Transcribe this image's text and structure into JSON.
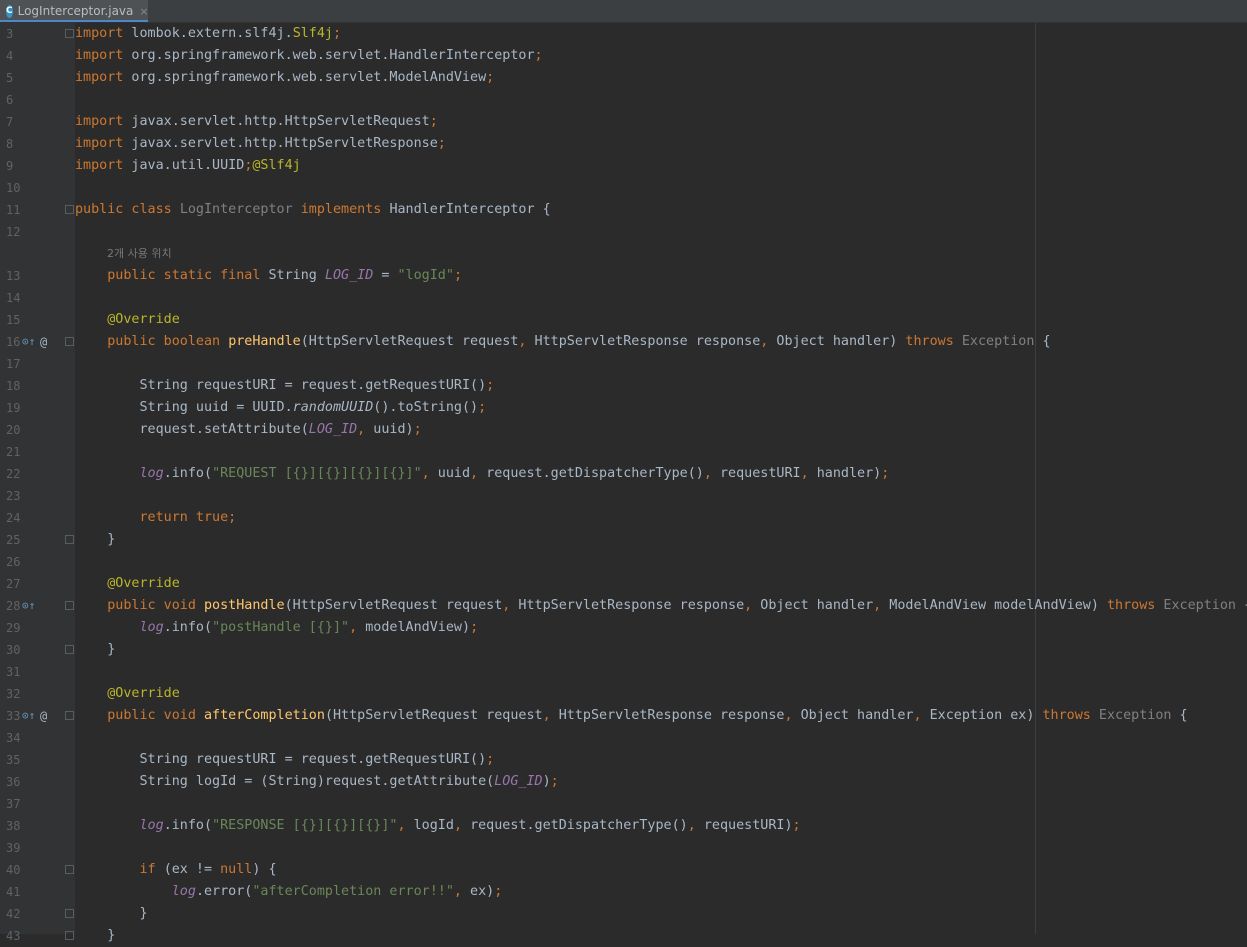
{
  "tab": {
    "filename": "LogInterceptor.java",
    "icon": "java-class-icon",
    "close": "×"
  },
  "colors": {
    "background": "#2b2b2b",
    "keyword": "#cc7832",
    "string": "#6a8759",
    "annotation": "#bbb529",
    "method": "#ffc66d",
    "constant": "#9876aa"
  },
  "code": {
    "l3": {
      "n": "3",
      "t": [
        [
          "kw",
          "import"
        ],
        [
          "p",
          " lombok.extern.slf4j."
        ],
        [
          "ann",
          "Slf4j"
        ],
        [
          "kw",
          ";"
        ]
      ]
    },
    "l4": {
      "n": "4",
      "t": [
        [
          "kw",
          "import"
        ],
        [
          "p",
          " org.springframework.web.servlet.HandlerInterceptor"
        ],
        [
          "kw",
          ";"
        ]
      ]
    },
    "l5": {
      "n": "5",
      "t": [
        [
          "kw",
          "import"
        ],
        [
          "p",
          " org.springframework.web.servlet.ModelAndView"
        ],
        [
          "kw",
          ";"
        ]
      ]
    },
    "l6": {
      "n": "6",
      "t": []
    },
    "l7": {
      "n": "7",
      "t": [
        [
          "kw",
          "import"
        ],
        [
          "p",
          " javax.servlet.http.HttpServletRequest"
        ],
        [
          "kw",
          ";"
        ]
      ]
    },
    "l8": {
      "n": "8",
      "t": [
        [
          "kw",
          "import"
        ],
        [
          "p",
          " javax.servlet.http.HttpServletResponse"
        ],
        [
          "kw",
          ";"
        ]
      ]
    },
    "l9": {
      "n": "9",
      "t": [
        [
          "kw",
          "import"
        ],
        [
          "p",
          " java.util.UUID"
        ],
        [
          "kw",
          ";"
        ],
        [
          "ann",
          "@Slf4j"
        ]
      ]
    },
    "l10": {
      "n": "10",
      "t": []
    },
    "l11": {
      "n": "11",
      "t": [
        [
          "kw",
          "public class "
        ],
        [
          "gr",
          "LogInterceptor "
        ],
        [
          "kw",
          "implements "
        ],
        [
          "p",
          "HandlerInterceptor {"
        ]
      ]
    },
    "l12": {
      "n": "12",
      "t": []
    },
    "hint": "2개 사용 위치",
    "l13": {
      "n": "13",
      "t": [
        [
          "p",
          "    "
        ],
        [
          "kw",
          "public static final "
        ],
        [
          "p",
          "String "
        ],
        [
          "cst",
          "LOG_ID"
        ],
        [
          "p",
          " = "
        ],
        [
          "str",
          "\"logId\""
        ],
        [
          "kw",
          ";"
        ]
      ]
    },
    "l14": {
      "n": "14",
      "t": []
    },
    "l15": {
      "n": "15",
      "t": [
        [
          "p",
          "    "
        ],
        [
          "ann",
          "@Override"
        ]
      ]
    },
    "l16": {
      "n": "16",
      "t": [
        [
          "p",
          "    "
        ],
        [
          "kw",
          "public boolean "
        ],
        [
          "fn",
          "preHandle"
        ],
        [
          "p",
          "(HttpServletRequest request"
        ],
        [
          "kw",
          ", "
        ],
        [
          "p",
          "HttpServletResponse response"
        ],
        [
          "kw",
          ", "
        ],
        [
          "p",
          "Object handler) "
        ],
        [
          "kw",
          "throws "
        ],
        [
          "gr",
          "Exception "
        ],
        [
          "p",
          "{"
        ]
      ]
    },
    "l17": {
      "n": "17",
      "t": []
    },
    "l18": {
      "n": "18",
      "t": [
        [
          "p",
          "        String requestURI = request.getRequestURI()"
        ],
        [
          "kw",
          ";"
        ]
      ]
    },
    "l19": {
      "n": "19",
      "t": [
        [
          "p",
          "        String uuid = UUID."
        ],
        [
          "it",
          "randomUUID"
        ],
        [
          "p",
          "().toString()"
        ],
        [
          "kw",
          ";"
        ]
      ]
    },
    "l20": {
      "n": "20",
      "t": [
        [
          "p",
          "        request.setAttribute("
        ],
        [
          "cst",
          "LOG_ID"
        ],
        [
          "kw",
          ", "
        ],
        [
          "p",
          "uuid)"
        ],
        [
          "kw",
          ";"
        ]
      ]
    },
    "l21": {
      "n": "21",
      "t": []
    },
    "l22": {
      "n": "22",
      "t": [
        [
          "p",
          "        "
        ],
        [
          "cst",
          "log"
        ],
        [
          "p",
          ".info("
        ],
        [
          "str",
          "\"REQUEST [{}][{}][{}][{}]\""
        ],
        [
          "kw",
          ", "
        ],
        [
          "p",
          "uuid"
        ],
        [
          "kw",
          ", "
        ],
        [
          "p",
          "request.getDispatcherType()"
        ],
        [
          "kw",
          ", "
        ],
        [
          "p",
          "requestURI"
        ],
        [
          "kw",
          ", "
        ],
        [
          "p",
          "handler)"
        ],
        [
          "kw",
          ";"
        ]
      ]
    },
    "l23": {
      "n": "23",
      "t": []
    },
    "l24": {
      "n": "24",
      "t": [
        [
          "p",
          "        "
        ],
        [
          "kw",
          "return true;"
        ]
      ]
    },
    "l25": {
      "n": "25",
      "t": [
        [
          "p",
          "    }"
        ]
      ]
    },
    "l26": {
      "n": "26",
      "t": []
    },
    "l27": {
      "n": "27",
      "t": [
        [
          "p",
          "    "
        ],
        [
          "ann",
          "@Override"
        ]
      ]
    },
    "l28": {
      "n": "28",
      "t": [
        [
          "p",
          "    "
        ],
        [
          "kw",
          "public void "
        ],
        [
          "fn",
          "postHandle"
        ],
        [
          "p",
          "(HttpServletRequest request"
        ],
        [
          "kw",
          ", "
        ],
        [
          "p",
          "HttpServletResponse response"
        ],
        [
          "kw",
          ", "
        ],
        [
          "p",
          "Object handler"
        ],
        [
          "kw",
          ", "
        ],
        [
          "p",
          "ModelAndView modelAndView) "
        ],
        [
          "kw",
          "throws "
        ],
        [
          "gr",
          "Exception "
        ],
        [
          "p",
          "{"
        ]
      ]
    },
    "l29": {
      "n": "29",
      "t": [
        [
          "p",
          "        "
        ],
        [
          "cst",
          "log"
        ],
        [
          "p",
          ".info("
        ],
        [
          "str",
          "\"postHandle [{}]\""
        ],
        [
          "kw",
          ", "
        ],
        [
          "p",
          "modelAndView)"
        ],
        [
          "kw",
          ";"
        ]
      ]
    },
    "l30": {
      "n": "30",
      "t": [
        [
          "p",
          "    }"
        ]
      ]
    },
    "l31": {
      "n": "31",
      "t": []
    },
    "l32": {
      "n": "32",
      "t": [
        [
          "p",
          "    "
        ],
        [
          "ann",
          "@Override"
        ]
      ]
    },
    "l33": {
      "n": "33",
      "t": [
        [
          "p",
          "    "
        ],
        [
          "kw",
          "public void "
        ],
        [
          "fn",
          "afterCompletion"
        ],
        [
          "p",
          "(HttpServletRequest request"
        ],
        [
          "kw",
          ", "
        ],
        [
          "p",
          "HttpServletResponse response"
        ],
        [
          "kw",
          ", "
        ],
        [
          "p",
          "Object handler"
        ],
        [
          "kw",
          ", "
        ],
        [
          "p",
          "Exception ex) "
        ],
        [
          "kw",
          "throws "
        ],
        [
          "gr",
          "Exception "
        ],
        [
          "p",
          "{"
        ]
      ]
    },
    "l34": {
      "n": "34",
      "t": []
    },
    "l35": {
      "n": "35",
      "t": [
        [
          "p",
          "        String requestURI = request.getRequestURI()"
        ],
        [
          "kw",
          ";"
        ]
      ]
    },
    "l36": {
      "n": "36",
      "t": [
        [
          "p",
          "        String logId = (String)request.getAttribute("
        ],
        [
          "cst",
          "LOG_ID"
        ],
        [
          "p",
          ")"
        ],
        [
          "kw",
          ";"
        ]
      ]
    },
    "l37": {
      "n": "37",
      "t": []
    },
    "l38": {
      "n": "38",
      "t": [
        [
          "p",
          "        "
        ],
        [
          "cst",
          "log"
        ],
        [
          "p",
          ".info("
        ],
        [
          "str",
          "\"RESPONSE [{}][{}][{}]\""
        ],
        [
          "kw",
          ", "
        ],
        [
          "p",
          "logId"
        ],
        [
          "kw",
          ", "
        ],
        [
          "p",
          "request.getDispatcherType()"
        ],
        [
          "kw",
          ", "
        ],
        [
          "p",
          "requestURI)"
        ],
        [
          "kw",
          ";"
        ]
      ]
    },
    "l39": {
      "n": "39",
      "t": []
    },
    "l40": {
      "n": "40",
      "t": [
        [
          "p",
          "        "
        ],
        [
          "kw",
          "if "
        ],
        [
          "p",
          "(ex != "
        ],
        [
          "kw",
          "null"
        ],
        [
          "p",
          ") {"
        ]
      ]
    },
    "l41": {
      "n": "41",
      "t": [
        [
          "p",
          "            "
        ],
        [
          "cst",
          "log"
        ],
        [
          "p",
          ".error("
        ],
        [
          "str",
          "\"afterCompletion error!!\""
        ],
        [
          "kw",
          ", "
        ],
        [
          "p",
          "ex)"
        ],
        [
          "kw",
          ";"
        ]
      ]
    },
    "l42": {
      "n": "42",
      "t": [
        [
          "p",
          "        }"
        ]
      ]
    },
    "l43": {
      "n": "43",
      "t": [
        [
          "p",
          "    }"
        ]
      ]
    }
  },
  "gutter": {
    "override_mark": "⊙↑",
    "at_mark": "@"
  }
}
